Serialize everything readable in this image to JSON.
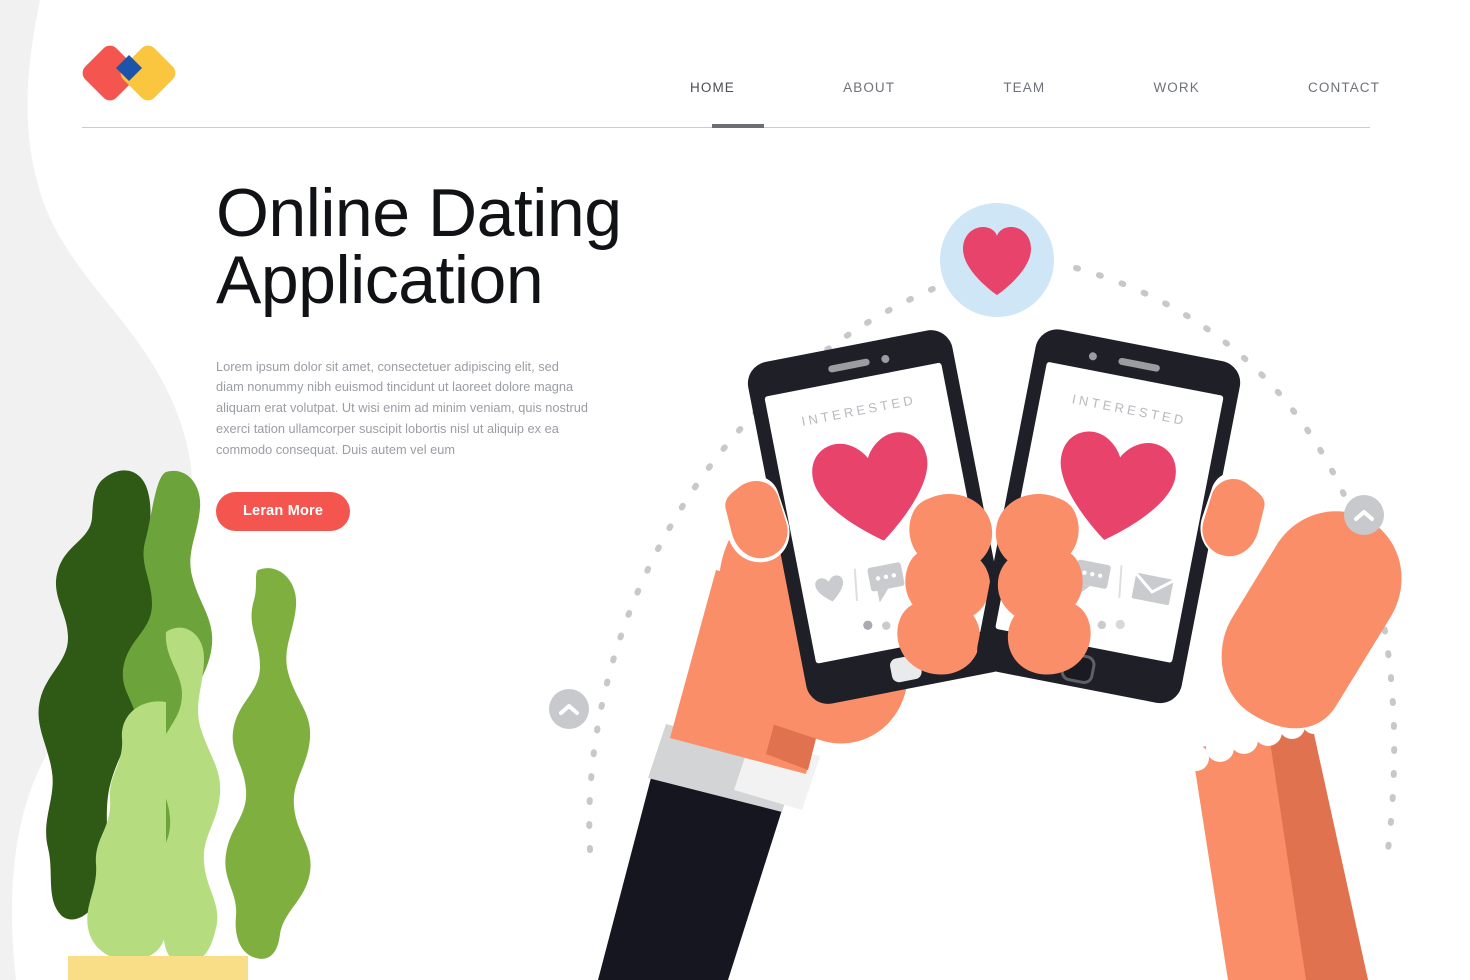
{
  "page": {
    "background_color": "#ffffff",
    "blob_color": "#f1f1f1"
  },
  "brand": {
    "logo_name": "overlapping-diamonds-logo",
    "colors": {
      "red": "#f4564f",
      "yellow": "#fbc63f",
      "blue": "#1b54a8"
    }
  },
  "nav": {
    "items": [
      {
        "label": "HOME",
        "active": true
      },
      {
        "label": "ABOUT",
        "active": false
      },
      {
        "label": "TEAM",
        "active": false
      },
      {
        "label": "WORK",
        "active": false
      },
      {
        "label": "CONTACT",
        "active": false
      }
    ]
  },
  "hero": {
    "title": "Online Dating\nApplication",
    "body": "Lorem ipsum dolor sit amet, consectetuer adipiscing elit, sed diam nonummy nibh euismod tincidunt ut laoreet dolore magna aliquam erat volutpat. Ut wisi enim ad minim veniam, quis nostrud exerci tation ullamcorper suscipit lobortis nisl ut aliquip ex ea commodo consequat. Duis autem vel eum",
    "cta_label": "Leran More",
    "cta_color": "#f4564f",
    "title_color": "#111216",
    "body_color": "#9a9da3"
  },
  "illustration": {
    "name": "two-hands-holding-phones-dating-app",
    "heart_badge": {
      "name": "heart-badge",
      "circle_color": "#cfe6f7",
      "heart_color": "#e8436b"
    },
    "arc": {
      "name": "dashed-arc",
      "color": "#c6c8cb",
      "style": "dashed"
    },
    "chevron_buttons": [
      {
        "name": "chevron-up-button-left",
        "icon": "chevron-up-icon",
        "circle_color": "#c7c9cc"
      },
      {
        "name": "chevron-up-button-right",
        "icon": "chevron-up-icon",
        "circle_color": "#c7c9cc"
      }
    ],
    "phones": [
      {
        "name": "phone-left",
        "label": "INTERESTED",
        "heart_color": "#e8436b",
        "body_color": "#1f2027",
        "screen_color": "#ffffff",
        "action_icons": [
          "heart-icon",
          "chat-bubble-icon",
          "envelope-icon"
        ],
        "page_dots": 3
      },
      {
        "name": "phone-right",
        "label": "INTERESTED",
        "heart_color": "#e8436b",
        "body_color": "#1f2027",
        "screen_color": "#ffffff",
        "action_icons": [
          "heart-icon",
          "chat-bubble-icon",
          "envelope-icon"
        ],
        "page_dots": 3
      }
    ],
    "hands": {
      "skin_color": "#f98e69",
      "skin_shade_color": "#e07250",
      "male_sleeve_color": "#15161f",
      "male_cuff_color": "#d3d4d6",
      "female_bracelet_color": "#ffffff"
    }
  },
  "plant": {
    "name": "potted-plant",
    "leaf_colors": [
      "#2f5a16",
      "#6ca33a",
      "#7fb03f",
      "#b5dd7f"
    ],
    "pot_color": "#fadd87"
  }
}
